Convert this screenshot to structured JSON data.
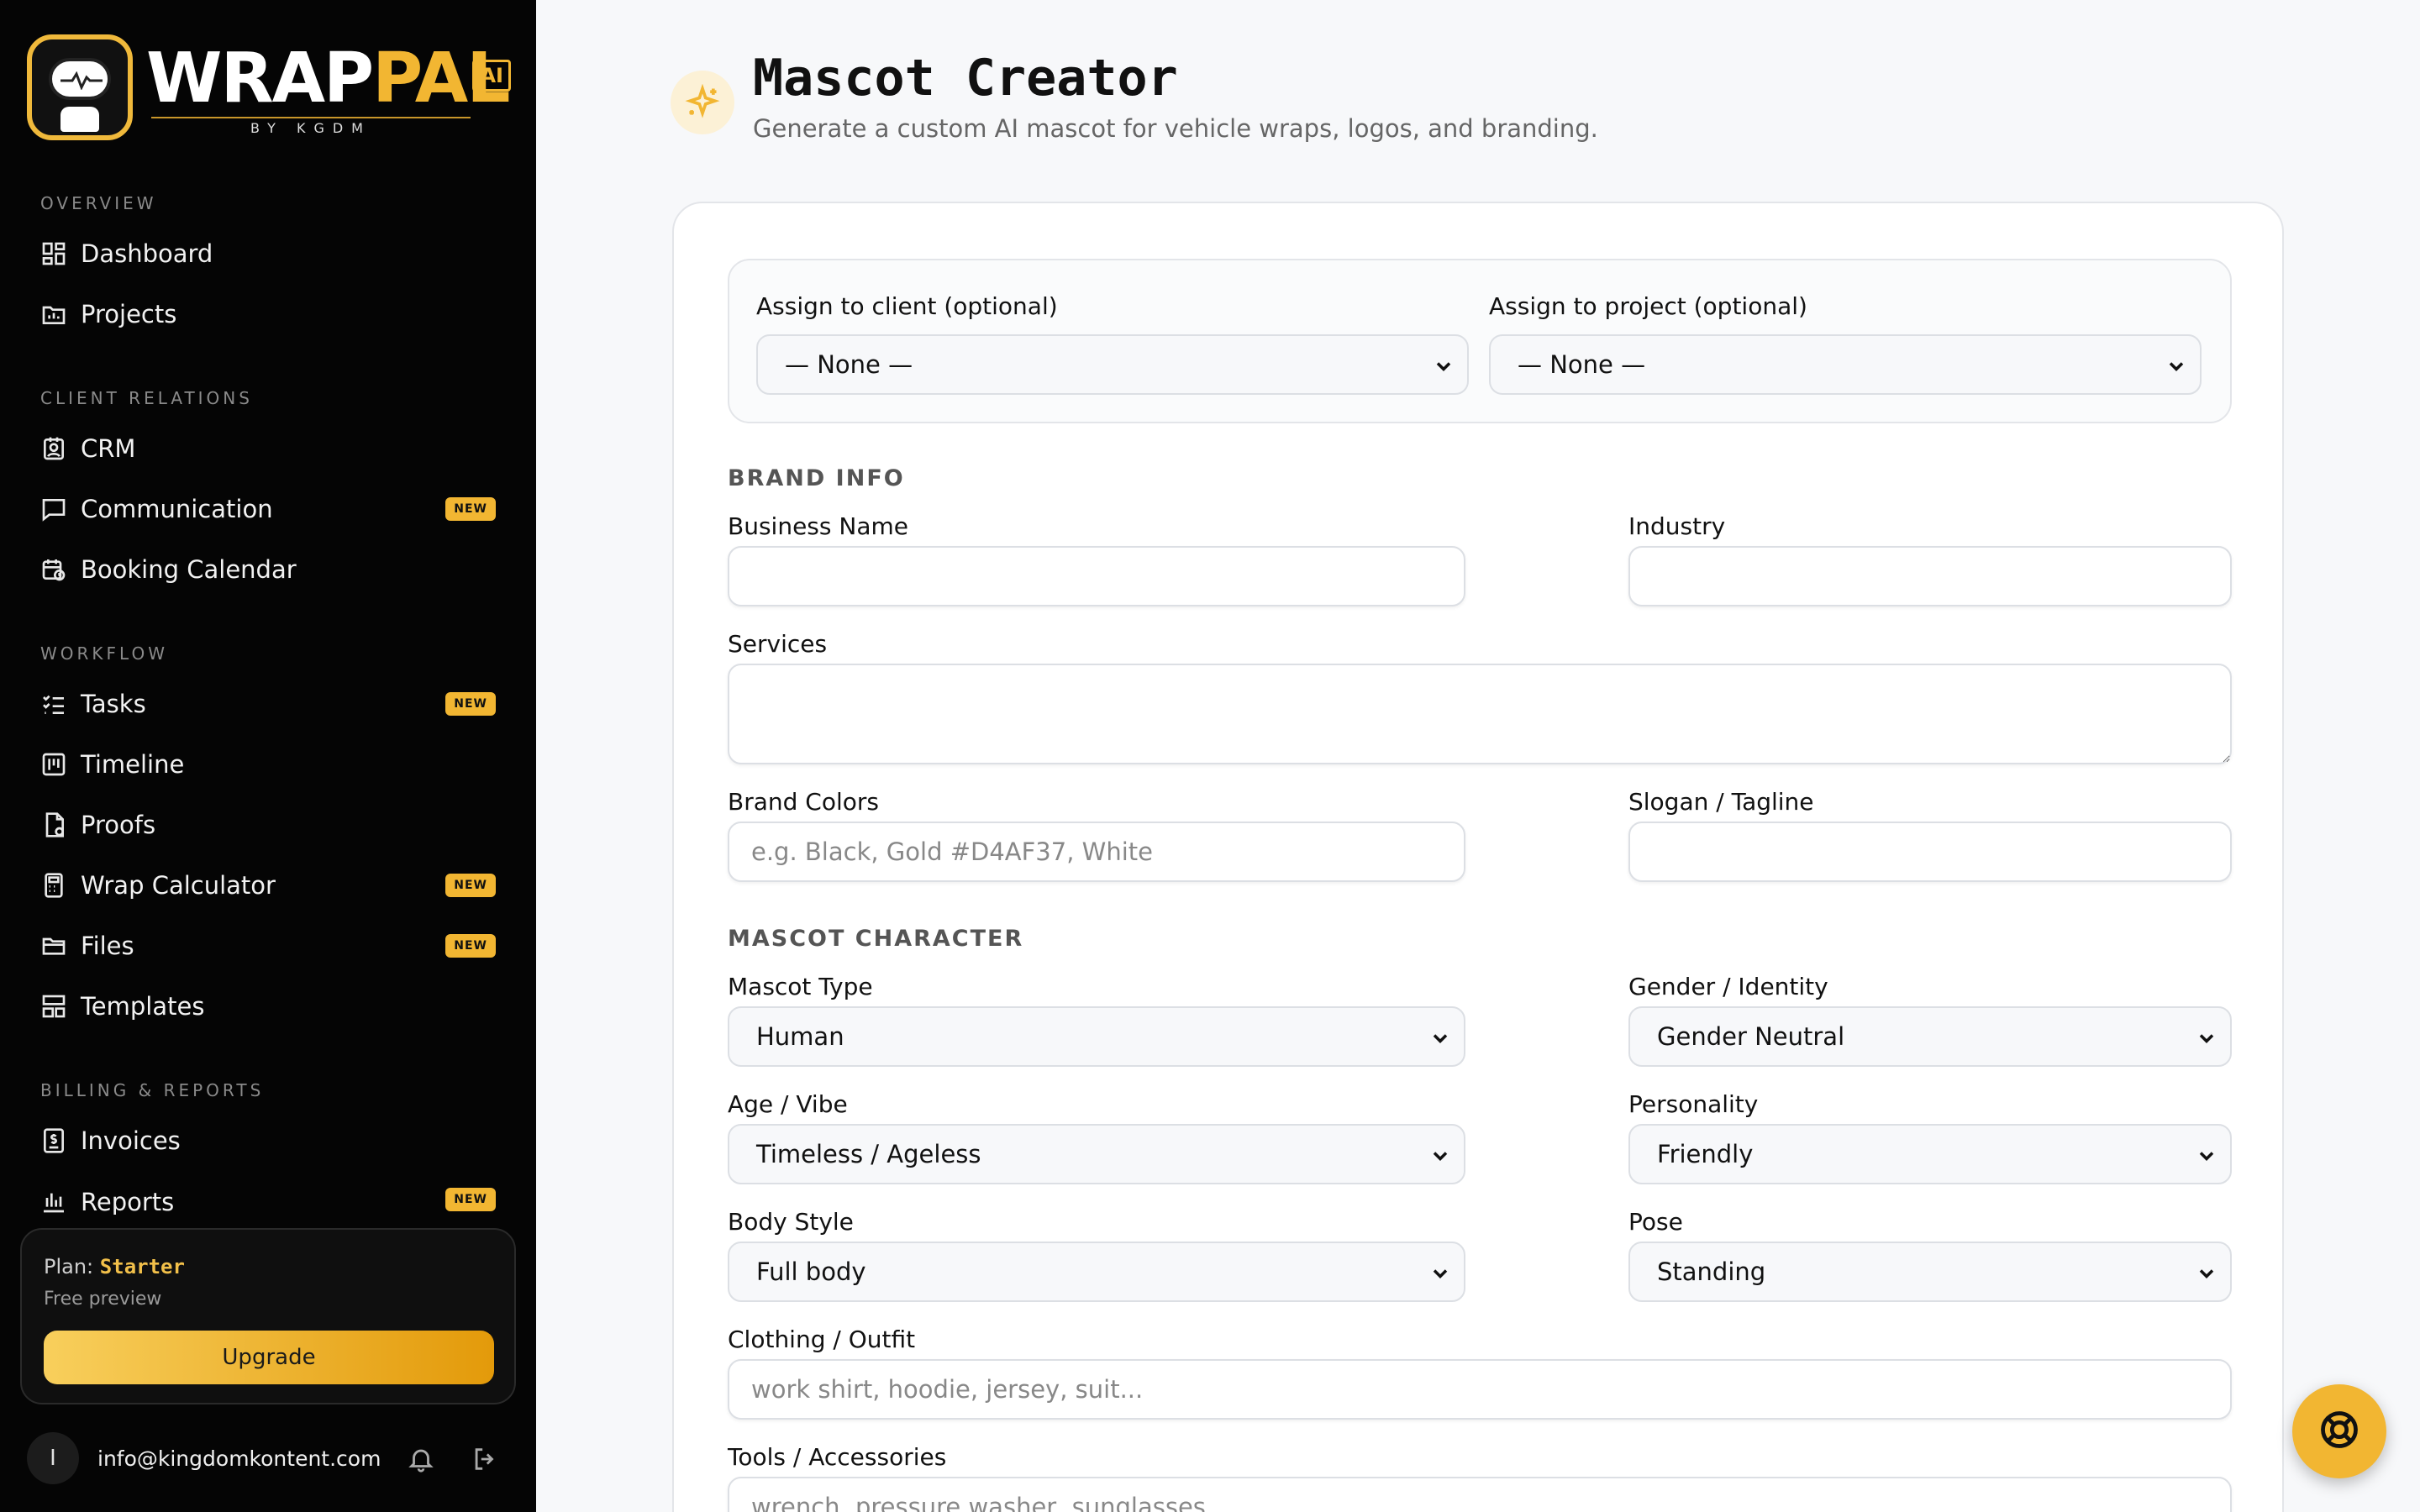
{
  "brand": {
    "logo_main_white": "WRAP",
    "logo_main_gold": "PAL",
    "logo_ai": "AI",
    "logo_sub": "BY KGDM"
  },
  "sidebar": {
    "sections": [
      {
        "title": "OVERVIEW"
      },
      {
        "title": "CLIENT RELATIONS"
      },
      {
        "title": "WORKFLOW"
      },
      {
        "title": "BILLING & REPORTS"
      }
    ],
    "items": [
      {
        "label": "Dashboard",
        "icon": "dashboard-icon"
      },
      {
        "label": "Projects",
        "icon": "projects-icon"
      },
      {
        "label": "CRM",
        "icon": "crm-icon"
      },
      {
        "label": "Communication",
        "icon": "chat-icon",
        "badge": "NEW"
      },
      {
        "label": "Booking Calendar",
        "icon": "calendar-icon"
      },
      {
        "label": "Tasks",
        "icon": "tasks-icon",
        "badge": "NEW"
      },
      {
        "label": "Timeline",
        "icon": "timeline-icon"
      },
      {
        "label": "Proofs",
        "icon": "proofs-icon"
      },
      {
        "label": "Wrap Calculator",
        "icon": "calculator-icon",
        "badge": "NEW"
      },
      {
        "label": "Files",
        "icon": "folder-icon",
        "badge": "NEW"
      },
      {
        "label": "Templates",
        "icon": "templates-icon"
      },
      {
        "label": "Invoices",
        "icon": "invoice-icon"
      },
      {
        "label": "Reports",
        "icon": "reports-icon",
        "badge": "NEW"
      }
    ],
    "plan": {
      "prefix": "Plan:",
      "name": "Starter",
      "sub": "Free preview",
      "upgrade_label": "Upgrade"
    },
    "user": {
      "initial": "I",
      "email": "info@kingdomkontent.com"
    }
  },
  "header": {
    "title": "Mascot Creator",
    "subtitle": "Generate a custom AI mascot for vehicle wraps, logos, and branding."
  },
  "form": {
    "assign_client_label": "Assign to client (optional)",
    "assign_client_value": "— None —",
    "assign_project_label": "Assign to project (optional)",
    "assign_project_value": "— None —",
    "brand_info_title": "BRAND INFO",
    "business_name_label": "Business Name",
    "business_name_value": "",
    "industry_label": "Industry",
    "industry_value": "",
    "services_label": "Services",
    "services_value": "",
    "brand_colors_label": "Brand Colors",
    "brand_colors_placeholder": "e.g. Black, Gold #D4AF37, White",
    "slogan_label": "Slogan / Tagline",
    "slogan_value": "",
    "mascot_character_title": "MASCOT CHARACTER",
    "mascot_type_label": "Mascot Type",
    "mascot_type_value": "Human",
    "gender_label": "Gender / Identity",
    "gender_value": "Gender Neutral",
    "age_label": "Age / Vibe",
    "age_value": "Timeless / Ageless",
    "personality_label": "Personality",
    "personality_value": "Friendly",
    "body_style_label": "Body Style",
    "body_style_value": "Full body",
    "pose_label": "Pose",
    "pose_value": "Standing",
    "clothing_label": "Clothing / Outfit",
    "clothing_placeholder": "work shirt, hoodie, jersey, suit...",
    "tools_label": "Tools / Accessories",
    "tools_placeholder": "wrench, pressure washer, sunglasses..."
  },
  "colors": {
    "accent": "#f2b632",
    "sidebar_bg": "#050505",
    "page_bg": "#f7f8fa"
  }
}
